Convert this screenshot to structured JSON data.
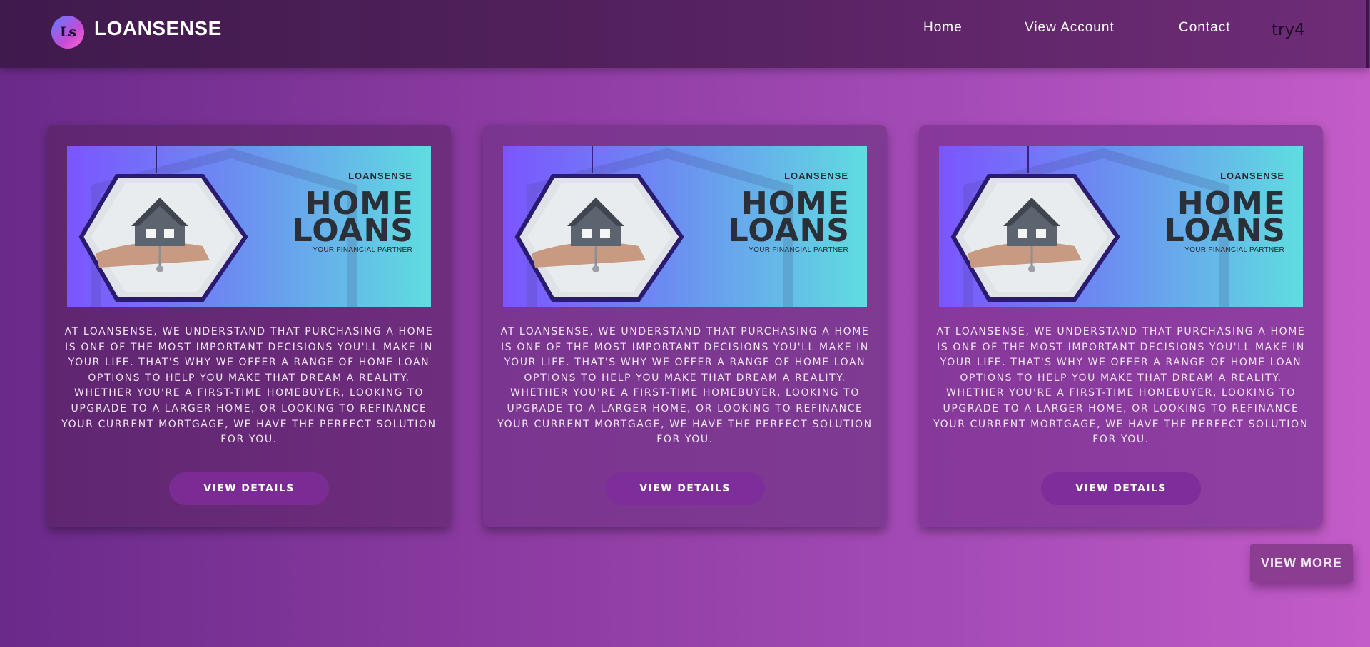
{
  "header": {
    "logo_text": "Ls",
    "brand": "LOANSENSE",
    "nav": [
      {
        "label": "Home"
      },
      {
        "label": "View Account"
      },
      {
        "label": "Contact"
      }
    ],
    "user": "try4"
  },
  "cards": [
    {
      "banner": {
        "brand": "LOANSENSE",
        "title_line1": "HOME",
        "title_line2": "LOANS",
        "subtitle": "YOUR FINANCIAL PARTNER"
      },
      "text": "AT LOANSENSE, WE UNDERSTAND THAT PURCHASING A HOME IS ONE OF THE MOST IMPORTANT DECISIONS YOU'LL MAKE IN YOUR LIFE. THAT'S WHY WE OFFER A RANGE OF HOME LOAN OPTIONS TO HELP YOU MAKE THAT DREAM A REALITY. WHETHER YOU'RE A FIRST-TIME HOMEBUYER, LOOKING TO UPGRADE TO A LARGER HOME, OR LOOKING TO REFINANCE YOUR CURRENT MORTGAGE, WE HAVE THE PERFECT SOLUTION FOR YOU.",
      "button": "VIEW DETAILS"
    },
    {
      "banner": {
        "brand": "LOANSENSE",
        "title_line1": "HOME",
        "title_line2": "LOANS",
        "subtitle": "YOUR FINANCIAL PARTNER"
      },
      "text": "AT LOANSENSE, WE UNDERSTAND THAT PURCHASING A HOME IS ONE OF THE MOST IMPORTANT DECISIONS YOU'LL MAKE IN YOUR LIFE. THAT'S WHY WE OFFER A RANGE OF HOME LOAN OPTIONS TO HELP YOU MAKE THAT DREAM A REALITY. WHETHER YOU'RE A FIRST-TIME HOMEBUYER, LOOKING TO UPGRADE TO A LARGER HOME, OR LOOKING TO REFINANCE YOUR CURRENT MORTGAGE, WE HAVE THE PERFECT SOLUTION FOR YOU.",
      "button": "VIEW DETAILS"
    },
    {
      "banner": {
        "brand": "LOANSENSE",
        "title_line1": "HOME",
        "title_line2": "LOANS",
        "subtitle": "YOUR FINANCIAL PARTNER"
      },
      "text": "AT LOANSENSE, WE UNDERSTAND THAT PURCHASING A HOME IS ONE OF THE MOST IMPORTANT DECISIONS YOU'LL MAKE IN YOUR LIFE. THAT'S WHY WE OFFER A RANGE OF HOME LOAN OPTIONS TO HELP YOU MAKE THAT DREAM A REALITY. WHETHER YOU'RE A FIRST-TIME HOMEBUYER, LOOKING TO UPGRADE TO A LARGER HOME, OR LOOKING TO REFINANCE YOUR CURRENT MORTGAGE, WE HAVE THE PERFECT SOLUTION FOR YOU.",
      "button": "VIEW DETAILS"
    }
  ],
  "view_more": "VIEW MORE",
  "colors": {
    "navbar": "#4a1d57",
    "background_start": "#6a2a8a",
    "background_end": "#c35cc8",
    "button": "#7d2e9a",
    "banner_start": "#7b55ff",
    "banner_end": "#5fdde0"
  }
}
